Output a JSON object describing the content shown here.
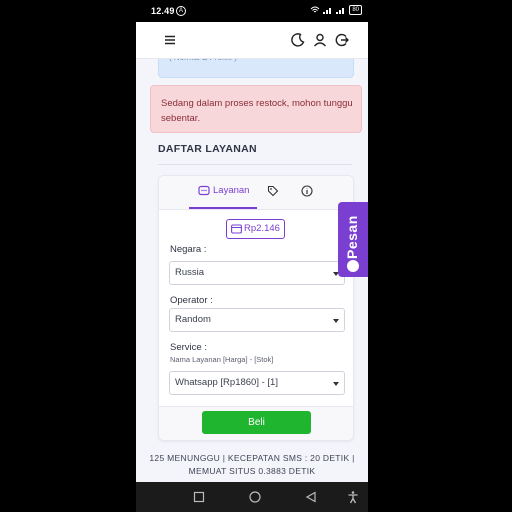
{
  "status_bar": {
    "time": "12.49",
    "battery": "80"
  },
  "header": {
    "menu_icon": "hamburger-icon",
    "theme_icon": "moon-icon",
    "profile_icon": "user-icon",
    "logout_icon": "logout-icon"
  },
  "info_alert": {
    "text": "( Normal & Profile )"
  },
  "warning_alert": {
    "text": "Sedang dalam proses restock, mohon tunggu sebentar."
  },
  "section": {
    "title": "DAFTAR LAYANAN"
  },
  "tabs": {
    "layanan_label": "Layanan"
  },
  "balance": {
    "value": "Rp2.146"
  },
  "form": {
    "negara_label": "Negara :",
    "negara_value": "Russia",
    "operator_label": "Operator :",
    "operator_value": "Random",
    "service_label": "Service :",
    "service_hint": "Nama Layanan [Harga] - [Stok]",
    "service_value": "Whatsapp [Rp1860] - [1]"
  },
  "buy_button": {
    "label": "Beli"
  },
  "footer": {
    "line1": "125 MENUNGGU | KECEPATAN SMS : 20 DETIK |",
    "line2": "MEMUAT SITUS 0.3883 DETIK"
  },
  "floating": {
    "label": "Pesan"
  },
  "colors": {
    "accent": "#7a3fd1",
    "success": "#1fb52e",
    "warning_bg": "#f8d7da",
    "info_bg": "#d9e8fb"
  }
}
